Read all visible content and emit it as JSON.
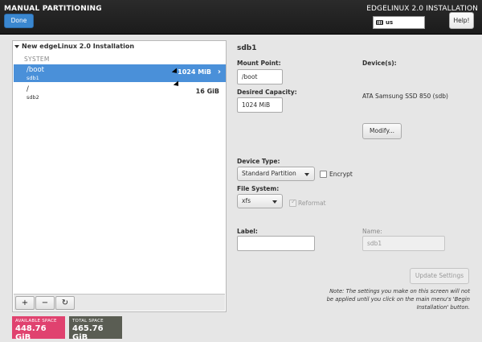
{
  "header": {
    "page_title": "MANUAL PARTITIONING",
    "done_label": "Done",
    "install_title": "EDGELINUX 2.0 INSTALLATION",
    "keyboard_layout": "us",
    "help_label": "Help!"
  },
  "tree": {
    "installation_label": "New edgeLinux 2.0 Installation",
    "group_label": "SYSTEM",
    "partitions": [
      {
        "mount": "/boot",
        "device": "sdb1",
        "size": "1024 MiB",
        "selected": true
      },
      {
        "mount": "/",
        "device": "sdb2",
        "size": "16 GiB",
        "selected": false
      }
    ],
    "toolbar": {
      "add": "+",
      "remove": "−",
      "refresh": "↻"
    }
  },
  "space": {
    "available_caption": "AVAILABLE SPACE",
    "available_value": "448.76 GiB",
    "total_caption": "TOTAL SPACE",
    "total_value": "465.76 GiB"
  },
  "details": {
    "heading": "sdb1",
    "mount_point_label": "Mount Point:",
    "mount_point_value": "/boot",
    "capacity_label": "Desired Capacity:",
    "capacity_value": "1024 MiB",
    "devices_label": "Device(s):",
    "device_name": "ATA Samsung SSD 850 (sdb)",
    "modify_label": "Modify...",
    "device_type_label": "Device Type:",
    "device_type_value": "Standard Partition",
    "encrypt_label": "Encrypt",
    "file_system_label": "File System:",
    "file_system_value": "xfs",
    "reformat_label": "Reformat",
    "label_label": "Label:",
    "label_value": "",
    "name_label": "Name:",
    "name_value": "sdb1",
    "update_label": "Update Settings",
    "note": "Note:  The settings you make on this screen will not be applied until you click on the main menu's 'Begin Installation' button."
  },
  "colors": {
    "accent": "#4a90d9",
    "done_button": "#3a87d0",
    "available_space": "#e0426f",
    "total_space": "#5a5d53"
  }
}
